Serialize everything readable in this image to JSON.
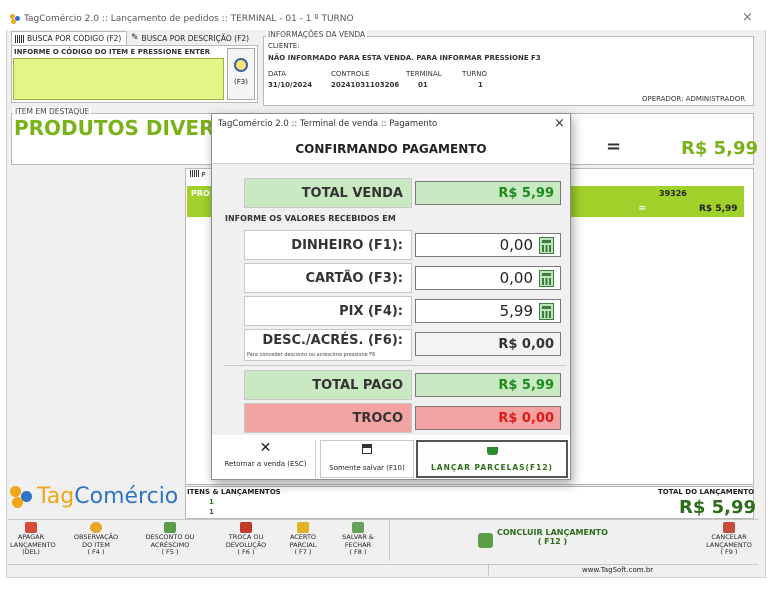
{
  "window": {
    "title": "TagComércio 2.0 :: Lançamento de pedidos :: TERMINAL - 01 - 1 º TURNO",
    "close_icon": "×"
  },
  "tabs": [
    {
      "label": "BUSCA POR CÓDIGO (F2)",
      "icon": "barcode-icon"
    },
    {
      "label": "BUSCA POR DESCRIÇÃO (F2)",
      "icon": "pencil-icon"
    }
  ],
  "item_code": {
    "label": "INFORME O CÓDIGO DO ITEM E PRESSIONE ENTER",
    "value": "",
    "search_key": "(F3)"
  },
  "sale_info": {
    "legend": "INFORMAÇÕES DA VENDA",
    "client_label": "CLIENTE:",
    "client_value": "NÃO INFORMADO PARA ESTA VENDA. PARA INFORMAR PRESSIONE F3",
    "data_label": "DATA",
    "data_value": "31/10/2024",
    "controle_label": "CONTROLE",
    "controle_value": "20241031103206",
    "terminal_label": "TERMINAL",
    "terminal_value": "01",
    "turno_label": "TURNO",
    "turno_value": "1",
    "operator": "OPERADOR: ADMINISTRADOR"
  },
  "featured": {
    "legend": "ITEM EM DESTAQUE",
    "name": "PRODUTOS DIVER",
    "equals": "=",
    "price": "R$ 5,99"
  },
  "items_grid": {
    "header_partial": "P",
    "row_name": "PRO",
    "row_code": "39326",
    "row_equals": "=",
    "row_total": "R$ 5,99"
  },
  "footer": {
    "brand_tag": "Tag",
    "brand_rest": "Comércio",
    "items_label": "ITENS & LANÇAMENTOS",
    "items_value": "1",
    "launches_value": "1",
    "total_label": "TOTAL DO LANÇAMENTO",
    "total_value": "R$ 5,99",
    "website": "www.TagSoft.com.br"
  },
  "toolbar": [
    {
      "l1": "APAGAR",
      "l2": "LANÇAMENTO",
      "l3": "(DEL)",
      "color": "#d84a3a"
    },
    {
      "l1": "OBSERVAÇÃO",
      "l2": "DO ITEM",
      "l3": "( F4 )",
      "color": "#e8a623"
    },
    {
      "l1": "DESCONTO OU",
      "l2": "ACRÉSCIMO",
      "l3": "( F5 )",
      "color": "#5a9e4a"
    },
    {
      "l1": "TROCA OU",
      "l2": "DEVOLUÇÃO",
      "l3": "( F6 )",
      "color": "#c43a2a"
    },
    {
      "l1": "ACERTO",
      "l2": "PARCIAL",
      "l3": "( F7 )",
      "color": "#e2b326"
    },
    {
      "l1": "SALVAR &",
      "l2": "FECHAR",
      "l3": "( F8 )",
      "color": "#6aa15a"
    },
    {
      "l1": "CANCELAR",
      "l2": "LANÇAMENTO",
      "l3": "( F9 )",
      "color": "#c84a3a"
    }
  ],
  "conclude": {
    "label": "CONCLUIR LANÇAMENTO",
    "key": "( F12 )"
  },
  "dialog": {
    "title": "TagComércio 2.0 :: Terminal de venda :: Pagamento",
    "heading": "CONFIRMANDO PAGAMENTO",
    "total_venda_label": "TOTAL VENDA",
    "total_venda_value": "R$ 5,99",
    "section_label": "INFORME OS VALORES RECEBIDOS EM",
    "dinheiro_label": "DINHEIRO (F1):",
    "dinheiro_value": "0,00",
    "cartao_label": "CARTÃO (F3):",
    "cartao_value": "0,00",
    "pix_label": "PIX (F4):",
    "pix_value": "5,99",
    "desc_label": "DESC./ACRÉS. (F6):",
    "desc_hint": "Para conceder desconto ou acréscimo pressione F6",
    "desc_value": "R$ 0,00",
    "total_pago_label": "TOTAL PAGO",
    "total_pago_value": "R$ 5,99",
    "troco_label": "TROCO",
    "troco_value": "R$ 0,00",
    "btn_return": "Retornar a venda (ESC)",
    "btn_save": "Somente salvar (F10)",
    "btn_parcelas": "LANÇAR PARCELAS(F12)",
    "close": "×"
  },
  "colors": {
    "accent_green": "#7ab317",
    "green_box": "#e5f486",
    "paid_bg": "#c8e9c1",
    "troco_bg": "#f4a3a3",
    "red_text": "#e01818",
    "green_text": "#1c8a1c"
  }
}
